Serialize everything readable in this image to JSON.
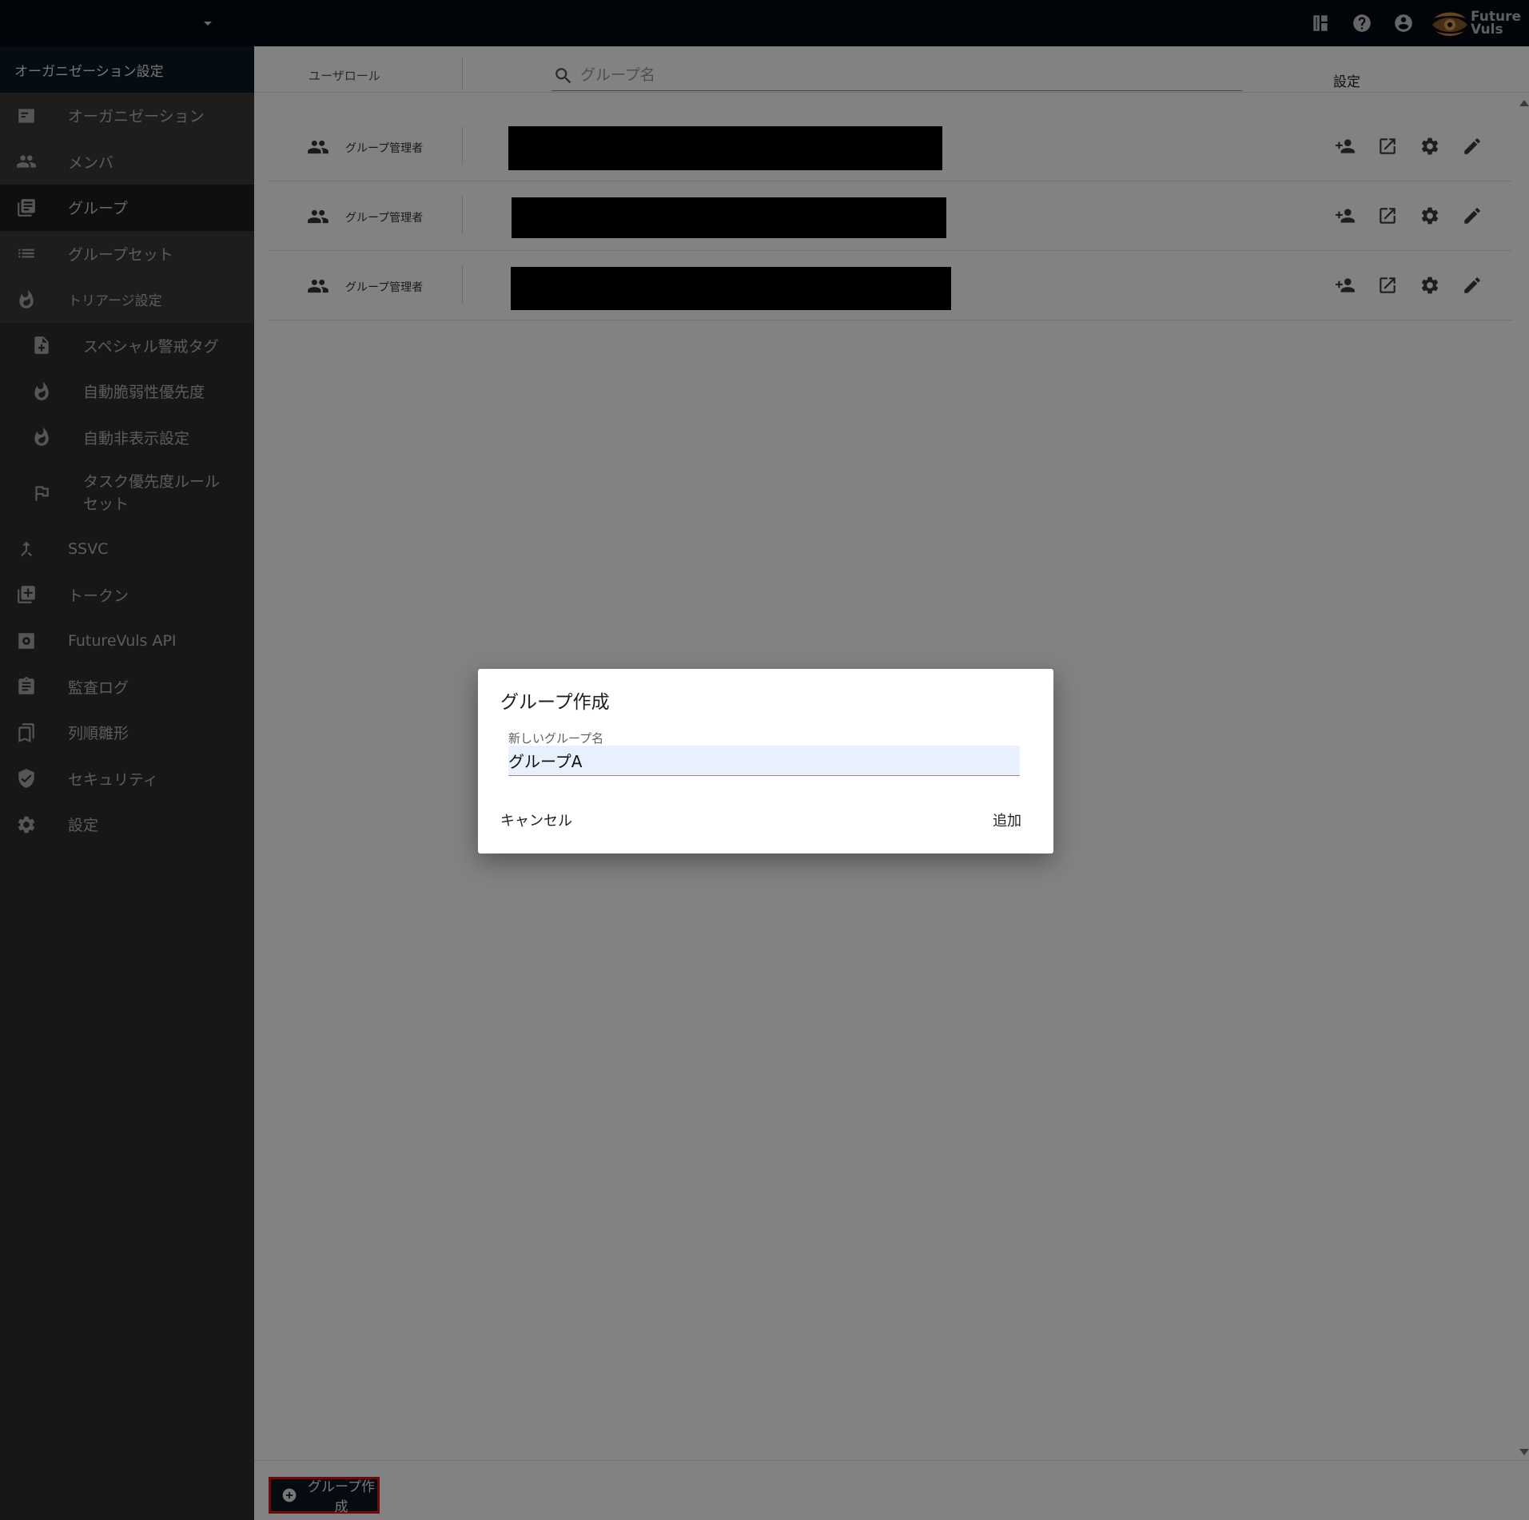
{
  "topbar": {
    "icons": [
      "layout-icon",
      "help-icon",
      "account-icon"
    ],
    "logo": {
      "line1": "Future",
      "line2": "Vuls"
    }
  },
  "sidebar": {
    "header": "オーガニゼーション設定",
    "items": [
      {
        "label": "オーガニゼーション",
        "icon": "organization-icon"
      },
      {
        "label": "メンバ",
        "icon": "people-icon"
      },
      {
        "label": "グループ",
        "icon": "library-icon",
        "active": true
      },
      {
        "label": "グループセット",
        "icon": "list-icon"
      },
      {
        "label": "トリアージ設定",
        "icon": "fire-icon"
      },
      {
        "label": "スペシャル警戒タグ",
        "icon": "note-add-icon"
      },
      {
        "label": "自動脆弱性優先度",
        "icon": "fire-icon"
      },
      {
        "label": "自動非表示設定",
        "icon": "fire-icon"
      },
      {
        "label": "タスク優先度ルールセット",
        "icon": "flag-icon"
      },
      {
        "label": "SSVC",
        "icon": "merge-icon"
      },
      {
        "label": "トークン",
        "icon": "library-add-icon"
      },
      {
        "label": "FutureVuls API",
        "icon": "api-settings-icon"
      },
      {
        "label": "監査ログ",
        "icon": "clipboard-icon"
      },
      {
        "label": "列順雛形",
        "icon": "bookmarks-icon"
      },
      {
        "label": "セキュリティ",
        "icon": "shield-icon"
      },
      {
        "label": "設定",
        "icon": "gear-icon"
      }
    ]
  },
  "table": {
    "header_role": "ユーザロール",
    "search_placeholder": "グループ名",
    "header_settings": "設定",
    "rows": [
      {
        "role": "グループ管理者",
        "name": ""
      },
      {
        "role": "グループ管理者",
        "name": ""
      },
      {
        "role": "グループ管理者",
        "name": ""
      }
    ]
  },
  "footer": {
    "create_label": "グループ作成"
  },
  "dialog": {
    "title": "グループ作成",
    "field_label": "新しいグループ名",
    "field_value": "グループA",
    "cancel_label": "キャンセル",
    "add_label": "追加"
  }
}
